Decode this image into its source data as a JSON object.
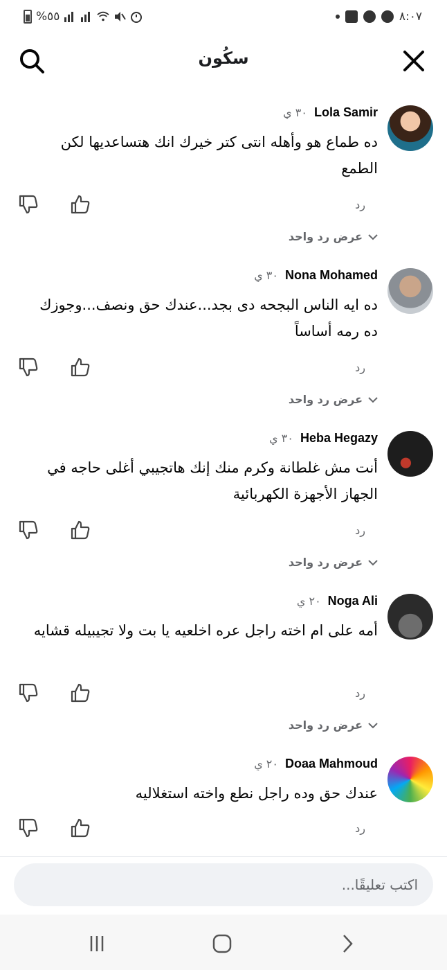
{
  "status_bar": {
    "time": "٨:٠٧",
    "battery": "%٥٥",
    "left_icons": [
      "notification-dot-icon",
      "gallery-icon",
      "facebook-icon",
      "messenger-icon"
    ],
    "right_icons": [
      "signal-icon",
      "signal-icon",
      "wifi-icon",
      "mute-icon",
      "alarm-icon"
    ]
  },
  "header": {
    "title": "سكُون",
    "search_icon": "search-icon",
    "close_icon": "close-icon"
  },
  "actions": {
    "reply_label": "رد",
    "view_replies_label": "عرض رد واحد"
  },
  "comments": [
    {
      "name": "Lola Samir",
      "time": "٣٠ ي",
      "text": "ده طماع هو وأهله انتى كتر خيرك انك هتساعديها لكن الطمع",
      "show_view_replies": true
    },
    {
      "name": "Nona Mohamed",
      "time": "٣٠ ي",
      "text": "ده ايه الناس البجحه دى بجد...عندك حق ونصف...وجوزك ده رمه أساساً",
      "show_view_replies": true
    },
    {
      "name": "Heba Hegazy",
      "time": "٣٠ ي",
      "text": "أنت مش غلطانة وكرم منك إنك هاتجيبي أغلى حاجه في الجهاز الأجهزة الكهربائية",
      "show_view_replies": true
    },
    {
      "name": "Noga Ali",
      "time": "٢٠ ي",
      "text": "أمه على ام اخته راجل عره اخلعيه يا بت ولا تجيبيله قشايه",
      "show_view_replies": true
    },
    {
      "name": "Doaa Mahmoud",
      "time": "٢٠ ي",
      "text": "عندك حق وده راجل نطع واخته استغلاليه",
      "show_view_replies": false
    }
  ],
  "composer": {
    "placeholder": "اكتب تعليقًا..."
  },
  "nav_bar": {
    "icons": [
      "recent-apps-icon",
      "home-icon",
      "back-icon"
    ]
  },
  "colors": {
    "background": "#ffffff",
    "text": "#050505",
    "meta": "#65676b",
    "composer_bg": "#f0f2f5"
  }
}
